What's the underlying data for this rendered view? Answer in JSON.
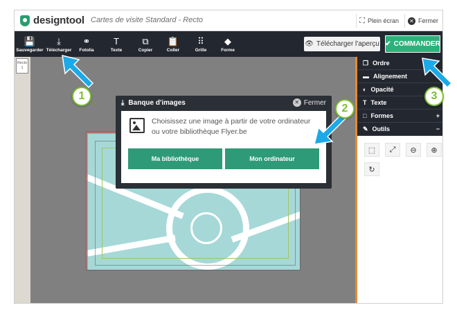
{
  "app": {
    "logo_text": "designtool",
    "doc_title": "Cartes de visite Standard - Recto",
    "accent": "#2db17a",
    "brand": "#2a9d6f"
  },
  "top_actions": {
    "fullscreen_label": "Plein écran",
    "close_label": "Fermer"
  },
  "toolbar": {
    "tools": [
      {
        "label": "Sauvegarder",
        "icon": "save-icon",
        "glyph": "💾"
      },
      {
        "label": "Télécharger",
        "icon": "download-icon",
        "glyph": "⤓"
      },
      {
        "label": "Fotolia",
        "icon": "fotolia-icon",
        "glyph": "⚭"
      },
      {
        "label": "Texte",
        "icon": "text-icon",
        "glyph": "T"
      },
      {
        "label": "Copier",
        "icon": "copy-icon",
        "glyph": "⧉"
      },
      {
        "label": "Coller",
        "icon": "paste-icon",
        "glyph": "📋"
      },
      {
        "label": "Grille",
        "icon": "grid-icon",
        "glyph": "⠿"
      },
      {
        "label": "Forme",
        "icon": "shape-icon",
        "glyph": "◆"
      }
    ],
    "preview_label": "Télécharger l'aperçu",
    "order_label": "COMMANDER"
  },
  "rail": {
    "thumb_label": "Recto",
    "thumb_number": "1"
  },
  "panel": {
    "items": [
      {
        "label": "Ordre",
        "icon": "order-icon",
        "glyph": "❐",
        "toggle": ""
      },
      {
        "label": "Alignement",
        "icon": "align-icon",
        "glyph": "▬",
        "toggle": ""
      },
      {
        "label": "Opacité",
        "icon": "opacity-icon",
        "glyph": "◐",
        "toggle": ""
      },
      {
        "label": "Texte",
        "icon": "text-icon",
        "glyph": "T",
        "toggle": ""
      },
      {
        "label": "Formes",
        "icon": "shapes-icon",
        "glyph": "□",
        "toggle": "+"
      },
      {
        "label": "Outils",
        "icon": "tools-icon",
        "glyph": "✎",
        "toggle": "−"
      }
    ],
    "tool_buttons": [
      {
        "name": "select-area-icon",
        "glyph": "⬚"
      },
      {
        "name": "fit-icon",
        "glyph": "⤢"
      },
      {
        "name": "zoom-out-icon",
        "glyph": "⊖"
      },
      {
        "name": "zoom-in-icon",
        "glyph": "⊕"
      },
      {
        "name": "rotate-icon",
        "glyph": "↻"
      }
    ]
  },
  "dialog": {
    "title": "Banque d'images",
    "close_label": "Fermer",
    "message": "Choisissez une image à partir de votre ordinateur ou votre bibliothèque Flyer.be",
    "library_button": "Ma bibliothèque",
    "computer_button": "Mon ordinateur"
  },
  "annotations": {
    "badges": [
      "1",
      "2",
      "3"
    ],
    "arrow_color": "#1ba9e8",
    "badge_color": "#7cbf2f"
  }
}
